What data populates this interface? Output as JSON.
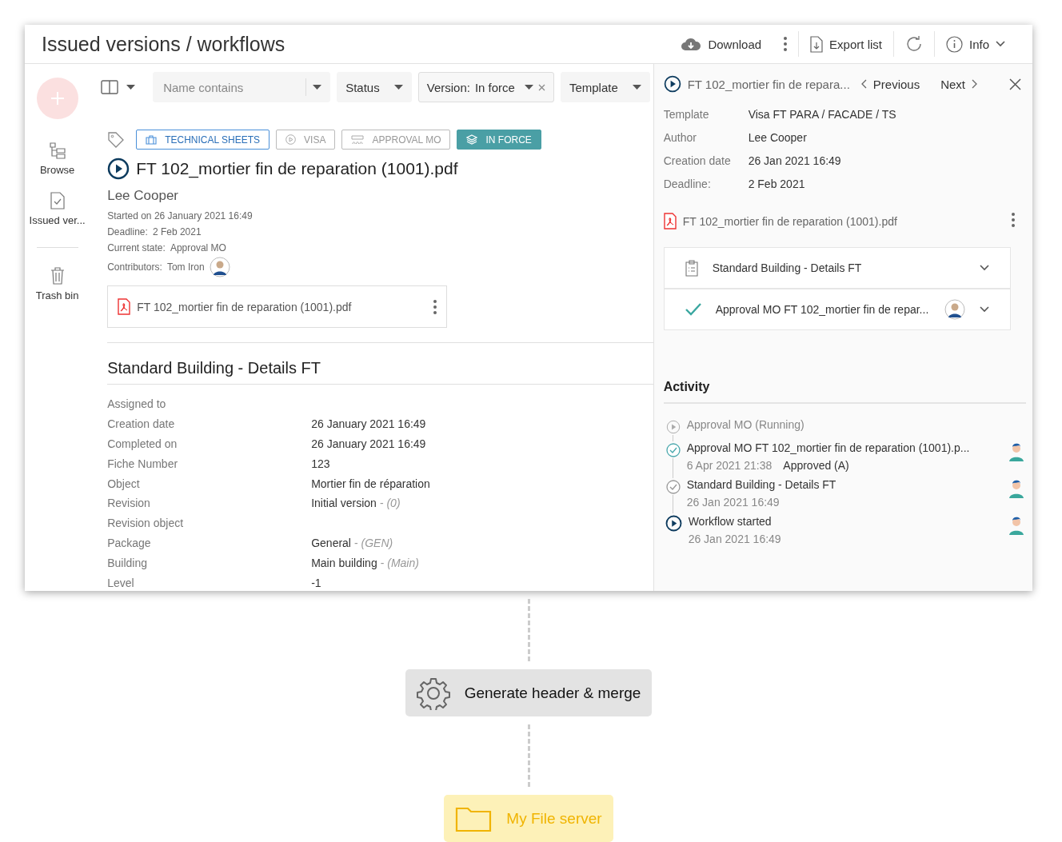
{
  "header": {
    "title": "Issued versions / workflows",
    "actions": [
      {
        "kind": "download",
        "label": "Download"
      },
      {
        "kind": "export",
        "label": "Export list"
      },
      {
        "kind": "refresh"
      },
      {
        "kind": "info",
        "label": "Info"
      }
    ]
  },
  "sidebar": {
    "items": [
      {
        "kind": "browse",
        "label": "Browse"
      },
      {
        "kind": "issued",
        "label": "Issued ver..."
      },
      {
        "kind": "trash",
        "label": "Trash bin"
      }
    ]
  },
  "filters": [
    {
      "kind": "search",
      "placeholder": "Name contains",
      "active": false
    },
    {
      "kind": "select",
      "label": "Status",
      "active": false
    },
    {
      "kind": "select",
      "label": "Version:",
      "value": "In force",
      "active": true
    },
    {
      "kind": "select",
      "label": "Template",
      "active": false
    }
  ],
  "document": {
    "tags": [
      {
        "kind": "category",
        "label": "TECHNICAL SHEETS"
      },
      {
        "kind": "workflow",
        "label": "VISA"
      },
      {
        "kind": "step",
        "label": "APPROVAL MO"
      },
      {
        "kind": "version",
        "label": "IN FORCE"
      }
    ],
    "title": "FT 102_mortier fin de reparation (1001).pdf",
    "author": "Lee Cooper",
    "started": "Started on 26 January 2021 16:49",
    "meta": [
      {
        "label": "Deadline:",
        "value": "2 Feb 2021"
      },
      {
        "label": "Current state:",
        "value": "Approval MO"
      }
    ],
    "contributors": {
      "label": "Contributors:",
      "value": "Tom Iron"
    },
    "file": "FT 102_mortier fin de reparation (1001).pdf"
  },
  "form": {
    "title": "Standard Building - Details FT",
    "fields": [
      {
        "label": "Assigned to"
      },
      {
        "label": "Creation date",
        "value": "26 January 2021 16:49"
      },
      {
        "label": "Completed on",
        "value": "26 January 2021 16:49"
      },
      {
        "label": "Fiche Number",
        "value": "123"
      },
      {
        "label": "Object",
        "value": "Mortier fin de réparation"
      },
      {
        "label": "Revision",
        "value": "Initial version",
        "detail": "- *(0)*"
      },
      {
        "label": "Revision object"
      },
      {
        "label": "Package",
        "value": "General",
        "detail": "- *(GEN)*"
      },
      {
        "label": "Building",
        "value": "Main building",
        "detail": "- *(Main)*"
      },
      {
        "label": "Level",
        "value": "-1"
      }
    ]
  },
  "panel": {
    "title": "FT 102_mortier fin de repara...",
    "previous": "Previous",
    "next": "Next",
    "properties": [
      {
        "label": "Template",
        "value": "Visa FT PARA / FACADE / TS"
      },
      {
        "label": "Author",
        "value": "Lee Cooper"
      },
      {
        "label": "Creation date",
        "value": "26 Jan 2021 16:49"
      },
      {
        "label": "Deadline:",
        "value": "2 Feb 2021"
      }
    ],
    "file": "FT 102_mortier fin de reparation (1001).pdf",
    "steps": [
      {
        "kind": "form",
        "label": "Standard Building - Details FT",
        "expanded": false
      },
      {
        "kind": "approval",
        "label": "Approval MO FT 102_mortier fin de repar...",
        "expanded": false
      }
    ],
    "activity": {
      "title": "Activity",
      "items": [
        {
          "kind": "running",
          "text": "Approval MO (Running)"
        },
        {
          "kind": "approved",
          "text": "Approval MO FT 102_mortier fin de reparation (1001).p...",
          "date": "6 Apr 2021 21:38",
          "result": "Approved (A)"
        },
        {
          "kind": "completed",
          "text": "Standard Building - Details FT",
          "date": "26 Jan 2021 16:49"
        },
        {
          "kind": "started",
          "text": "Workflow started",
          "date": "26 Jan 2021 16:49"
        }
      ]
    }
  },
  "flow": [
    {
      "kind": "process",
      "label": "Generate header & merge"
    },
    {
      "kind": "destination",
      "label": "My File server"
    }
  ]
}
